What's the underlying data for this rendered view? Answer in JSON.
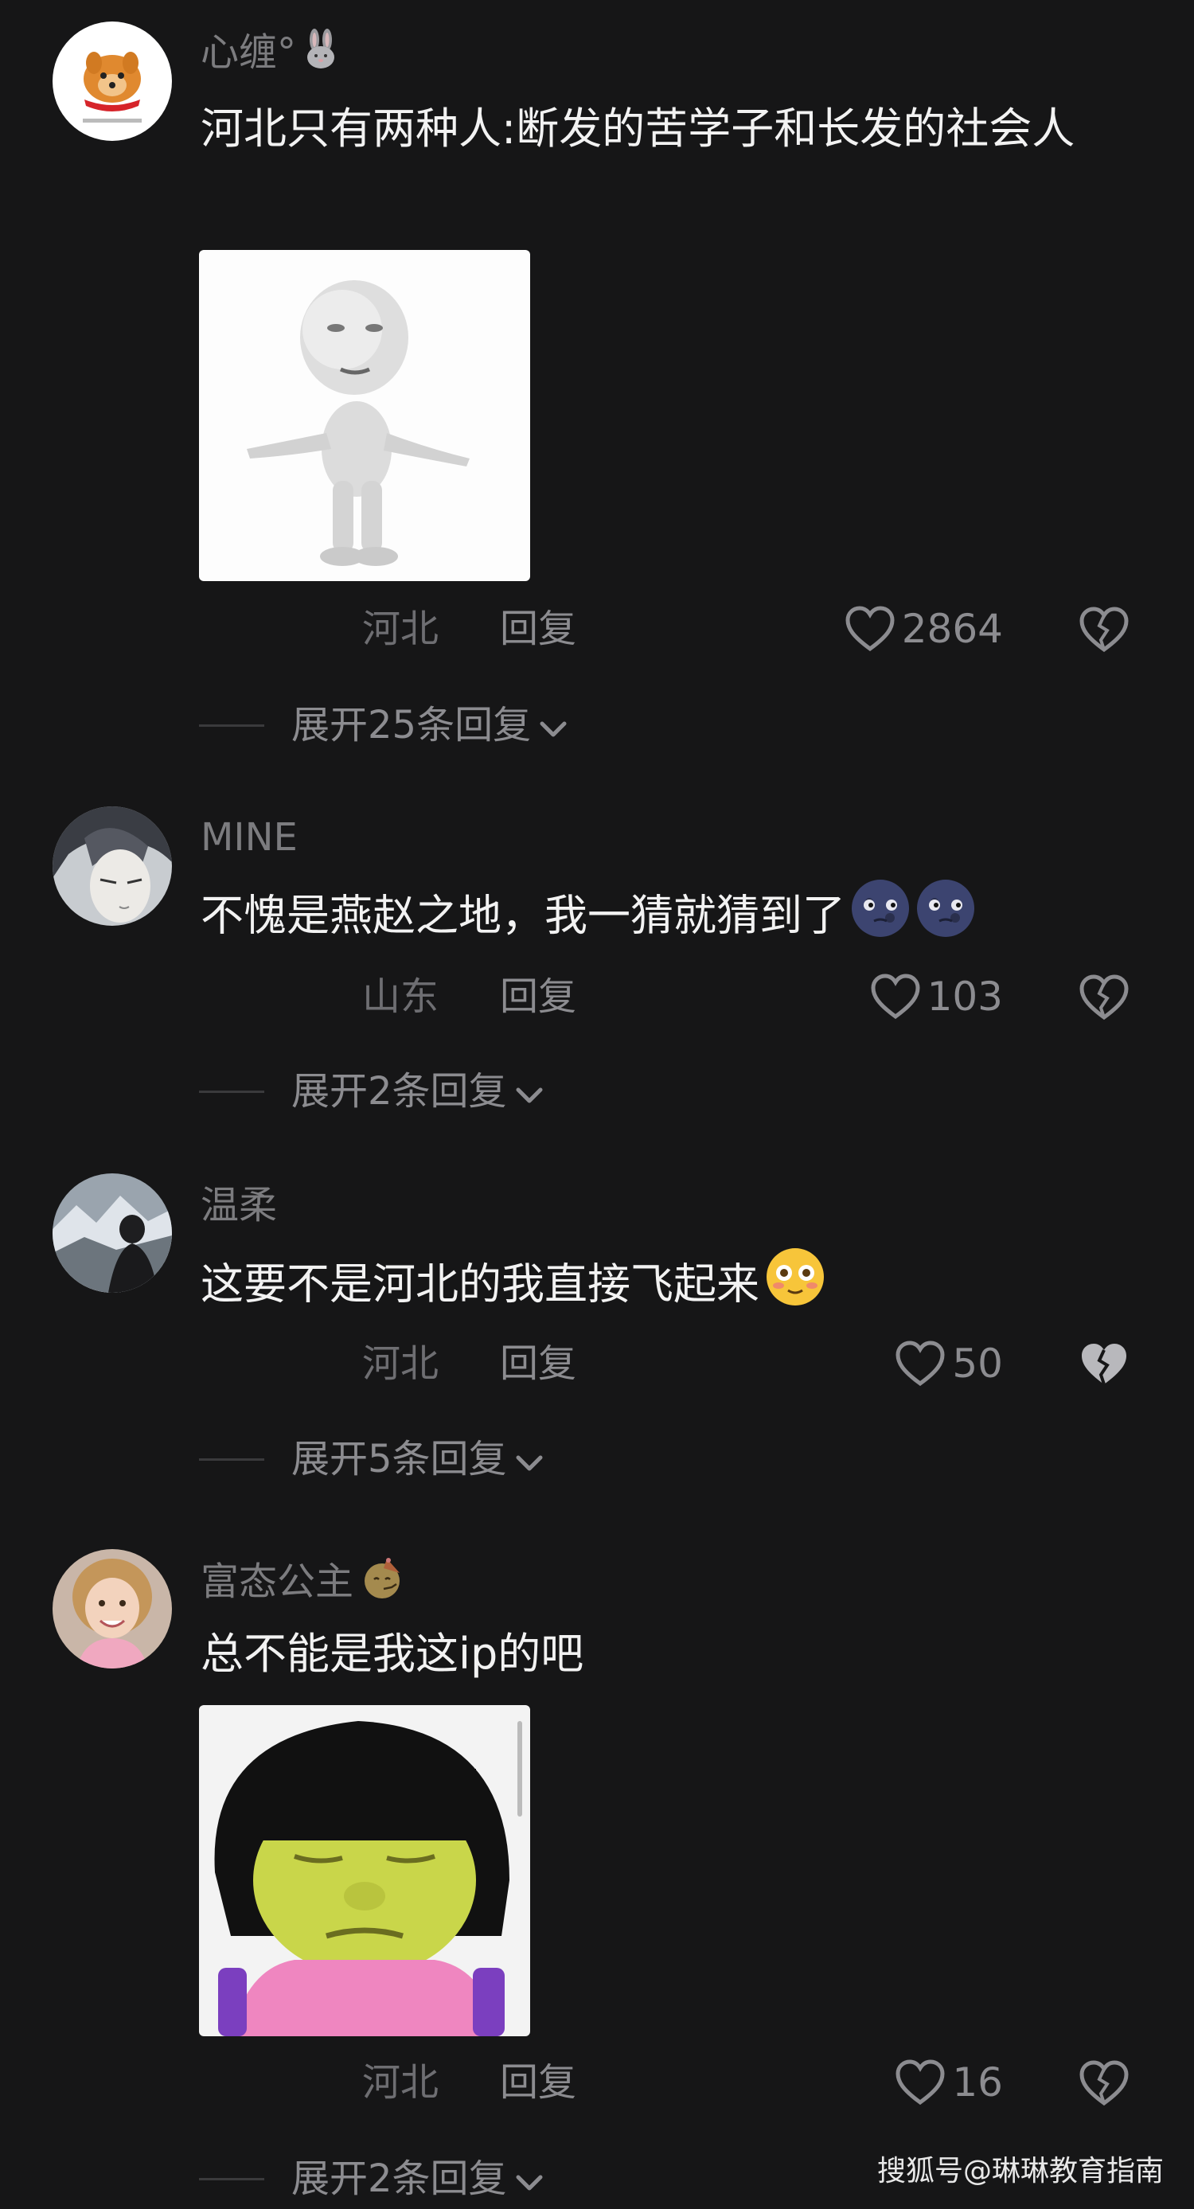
{
  "comments": [
    {
      "username": "心缠°",
      "badge_icon": "rabbit-icon",
      "text": "河北只有两种人:断发的苦学子和长发的社会人",
      "location": "河北",
      "reply_label": "回复",
      "likes": "2864",
      "expand_label": "展开25条回复"
    },
    {
      "username": "MINE",
      "text": "不愧是燕赵之地，我一猜就猜到了",
      "emoji": [
        "moon-face-emoji",
        "moon-face-emoji"
      ],
      "location": "山东",
      "reply_label": "回复",
      "likes": "103",
      "expand_label": "展开2条回复"
    },
    {
      "username": "温柔",
      "text": "这要不是河北的我直接飞起来",
      "emoji": [
        "flushed-face-emoji"
      ],
      "location": "河北",
      "reply_label": "回复",
      "likes": "50",
      "expand_label": "展开5条回复"
    },
    {
      "username": "富态公主",
      "badge_icon": "party-face-icon",
      "text": "总不能是我这ip的吧",
      "location": "河北",
      "reply_label": "回复",
      "likes": "16",
      "expand_label": "展开2条回复"
    }
  ],
  "watermark": "搜狐号@琳琳教育指南",
  "colors": {
    "background": "#161617",
    "text": "#f2f2f2",
    "muted": "#8c8c90",
    "location": "#6e6e72"
  }
}
